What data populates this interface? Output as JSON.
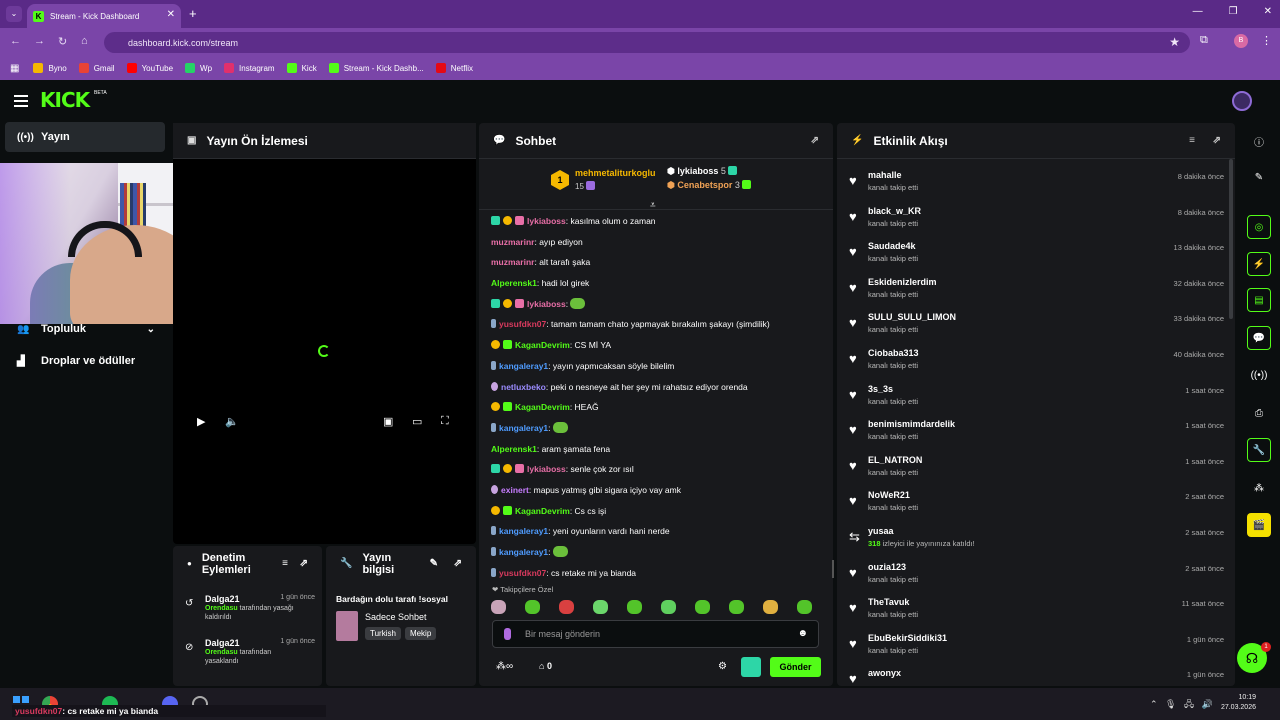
{
  "browser": {
    "tab_title": "Stream - Kick Dashboard",
    "url": "dashboard.kick.com/stream",
    "profile_initial": "B",
    "bookmarks": [
      {
        "label": "Byno",
        "color": "#f5b800"
      },
      {
        "label": "Gmail",
        "color": "#ea4335"
      },
      {
        "label": "YouTube",
        "color": "#ff0000"
      },
      {
        "label": "Wp",
        "color": "#25d366"
      },
      {
        "label": "Instagram",
        "color": "#e1306c"
      },
      {
        "label": "Kick",
        "color": "#53fc18"
      },
      {
        "label": "Stream - Kick Dashb...",
        "color": "#53fc18"
      },
      {
        "label": "Netflix",
        "color": "#e50914"
      }
    ]
  },
  "kick": {
    "logo": "KICK",
    "beta": "BETA",
    "accent": "#53fc18"
  },
  "leftnav": {
    "yayin": "Yayın",
    "topluluk": "Topluluk",
    "droplar": "Droplar ve ödüller"
  },
  "preview": {
    "title": "Yayın Ön İzlemesi"
  },
  "moderation": {
    "title": "Denetim Eylemleri",
    "rows": [
      {
        "name": "Dalga21",
        "time": "1 gün önce",
        "by": "Orendasu",
        "text1": "tarafından yasağı",
        "text2": "kaldırıldı"
      },
      {
        "name": "Dalga21",
        "time": "1 gün önce",
        "by": "Orendasu",
        "text1": "tarafından",
        "text2": "yasaklandı"
      }
    ]
  },
  "streaminfo": {
    "title": "Yayın bilgisi",
    "stream_title": "Bardağın dolu tarafı !sosyal",
    "category": "Sadece Sohbet",
    "tags": [
      "Turkish",
      "Mekip"
    ]
  },
  "chat": {
    "title": "Sohbet",
    "pinned": {
      "top_user": "mehmetaliturkoglu",
      "top_rank": "1",
      "top_count": "15",
      "u2": "lykiaboss",
      "u2_count": "5",
      "u3": "Cenabetspor",
      "u3_count": "3"
    },
    "messages": [
      {
        "user": "lykiaboss",
        "color": "#e86fa7",
        "text": "kasılma olum o zaman"
      },
      {
        "user": "muzmarinr",
        "color": "#e86fa7",
        "text": "ayıp ediyon"
      },
      {
        "user": "muzmarinr",
        "color": "#e86fa7",
        "text": "alt tarafı şaka"
      },
      {
        "user": "Alperensk1",
        "color": "#53fc18",
        "text": "hadi lol girek"
      },
      {
        "user": "lykiaboss",
        "color": "#e86fa7",
        "text": ""
      },
      {
        "user": "yusufdkn07",
        "color": "#d83a5e",
        "text": "tamam tamam chato yapmayak bırakalım şakayı (şimdilik)"
      },
      {
        "user": "KaganDevrim",
        "color": "#53fc18",
        "text": "CS Mİ YA"
      },
      {
        "user": "kangaleray1",
        "color": "#4f9cff",
        "text": "yayın yapmıcaksan söyle bilelim"
      },
      {
        "user": "netluxbeko",
        "color": "#9b8cff",
        "text": "peki o nesneye ait her şey mi rahatsız ediyor orenda"
      },
      {
        "user": "KaganDevrim",
        "color": "#53fc18",
        "text": "HEAĞ"
      },
      {
        "user": "kangaleray1",
        "color": "#4f9cff",
        "text": ""
      },
      {
        "user": "Alperensk1",
        "color": "#53fc18",
        "text": "aram şamata fena"
      },
      {
        "user": "lykiaboss",
        "color": "#e86fa7",
        "text": "senle çok zor ısıl"
      },
      {
        "user": "exinert",
        "color": "#c77dff",
        "text": "mapus yatmış gibi sigara içiyo     vay amk"
      },
      {
        "user": "KaganDevrim",
        "color": "#53fc18",
        "text": "Cs cs işi"
      },
      {
        "user": "kangaleray1",
        "color": "#4f9cff",
        "text": "yeni oyunların vardı hani nerde"
      },
      {
        "user": "kangaleray1",
        "color": "#4f9cff",
        "text": ""
      },
      {
        "user": "yusufdkn07",
        "color": "#d83a5e",
        "text": "cs retake mi ya bianda"
      }
    ],
    "followers_only": "Takipçilere Özel",
    "placeholder": "Bir mesaj gönderin",
    "points": "0",
    "send": "Gönder"
  },
  "activity": {
    "title": "Etkinlik Akışı",
    "items": [
      {
        "icon": "heart-icon",
        "name": "mahalle",
        "desc": "kanalı takip etti",
        "time": "8 dakika önce"
      },
      {
        "icon": "heart-icon",
        "name": "black_w_KR",
        "desc": "kanalı takip etti",
        "time": "8 dakika önce"
      },
      {
        "icon": "heart-icon",
        "name": "Saudade4k",
        "desc": "kanalı takip etti",
        "time": "13 dakika önce"
      },
      {
        "icon": "heart-icon",
        "name": "Eskidenizlerdim",
        "desc": "kanalı takip etti",
        "time": "32 dakika önce"
      },
      {
        "icon": "heart-icon",
        "name": "SULU_SULU_LIMON",
        "desc": "kanalı takip etti",
        "time": "33 dakika önce"
      },
      {
        "icon": "heart-icon",
        "name": "Ciobaba313",
        "desc": "kanalı takip etti",
        "time": "40 dakika önce"
      },
      {
        "icon": "heart-icon",
        "name": "3s_3s",
        "desc": "kanalı takip etti",
        "time": "1 saat önce"
      },
      {
        "icon": "heart-icon",
        "name": "benimismimdardelik",
        "desc": "kanalı takip etti",
        "time": "1 saat önce"
      },
      {
        "icon": "heart-icon",
        "name": "EL_NATRON",
        "desc": "kanalı takip etti",
        "time": "1 saat önce"
      },
      {
        "icon": "heart-icon",
        "name": "NoWeR21",
        "desc": "kanalı takip etti",
        "time": "2 saat önce"
      },
      {
        "icon": "raid-icon",
        "name": "yusaa",
        "desc_num": "318",
        "desc": "izleyici ile yayınınıza katıldı!",
        "time": "2 saat önce"
      },
      {
        "icon": "heart-icon",
        "name": "ouzia123",
        "desc": "kanalı takip etti",
        "time": "2 saat önce"
      },
      {
        "icon": "heart-icon",
        "name": "TheTavuk",
        "desc": "kanalı takip etti",
        "time": "11 saat önce"
      },
      {
        "icon": "heart-icon",
        "name": "EbuBekirSiddiki31",
        "desc": "kanalı takip etti",
        "time": "1 gün önce"
      },
      {
        "icon": "heart-icon",
        "name": "awonyx",
        "desc": "",
        "time": "1 gün önce"
      }
    ]
  },
  "overlay": {
    "user": "yusufdkn07",
    "text": ": cs retake mi ya bianda"
  },
  "clock": {
    "time": "10:19",
    "date": "27.03.2026"
  },
  "support_badge": "1"
}
